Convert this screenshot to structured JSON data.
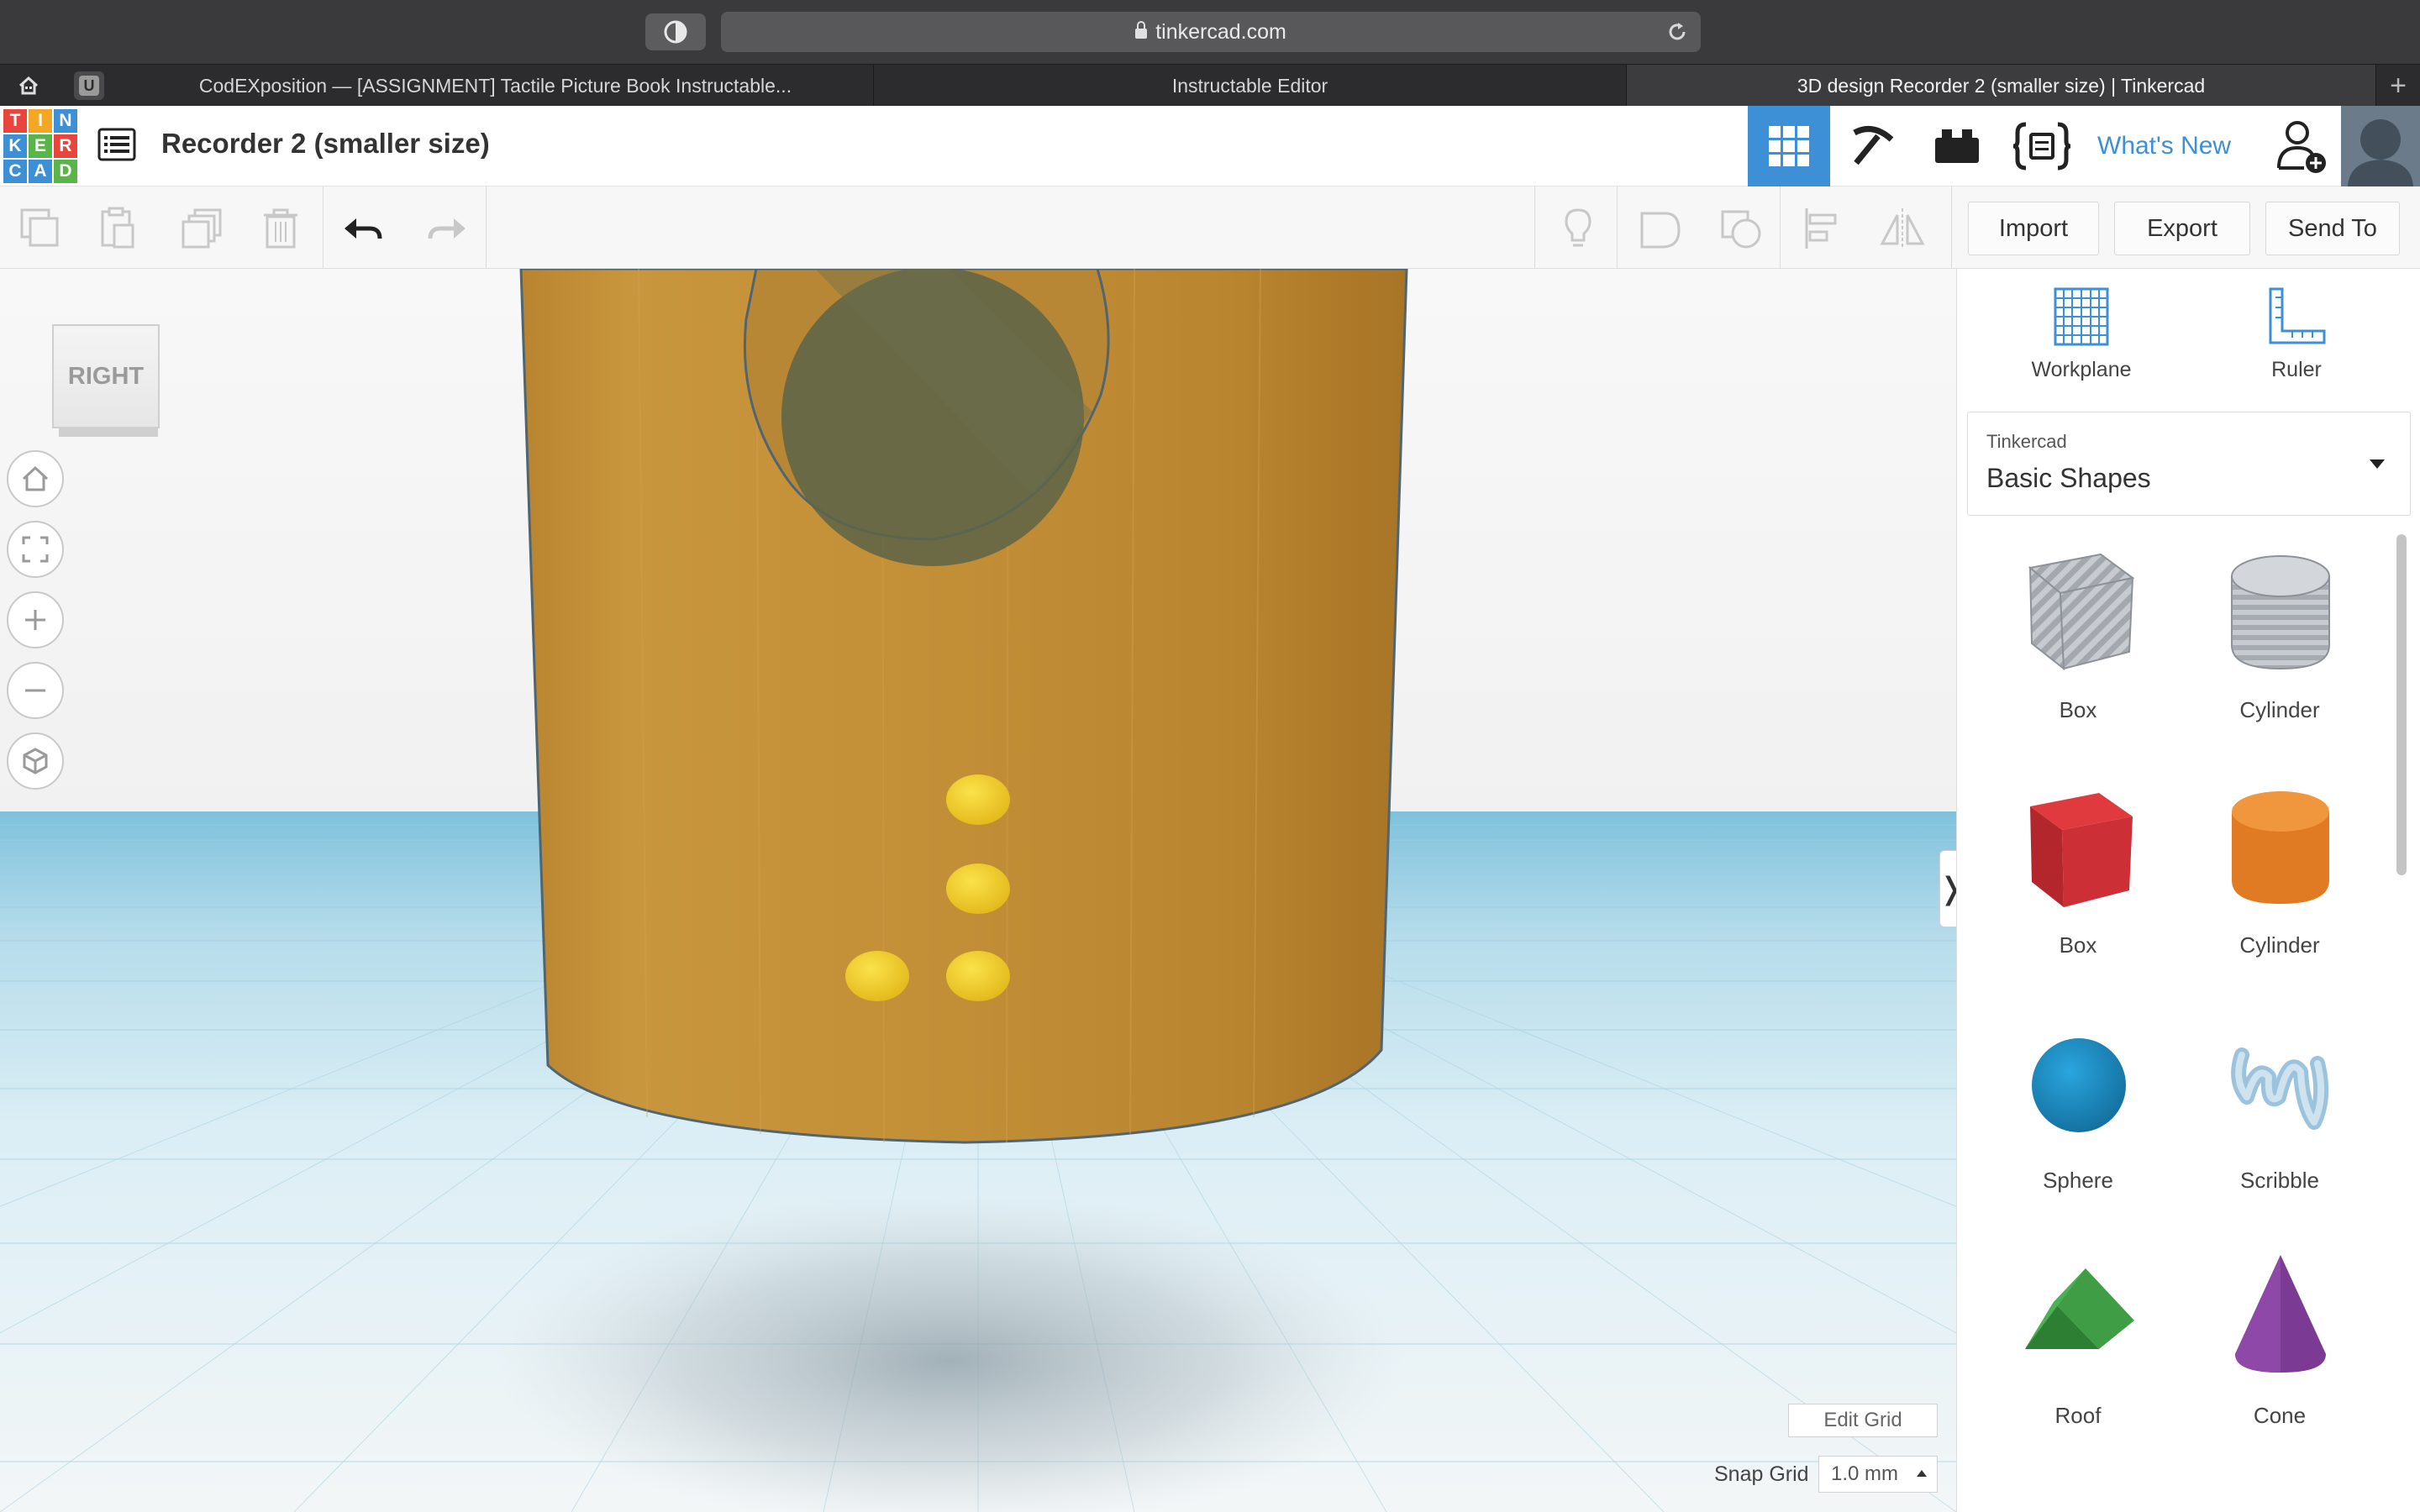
{
  "browser": {
    "url": "tinkercad.com",
    "tabs": [
      {
        "label": "CodEXposition — [ASSIGNMENT] Tactile Picture Book Instructable..."
      },
      {
        "label": "Instructable Editor"
      },
      {
        "label": "3D design Recorder 2 (smaller size) | Tinkercad"
      }
    ],
    "pinned_tab_letter": "U"
  },
  "header": {
    "logo_letters": [
      "T",
      "I",
      "N",
      "K",
      "E",
      "R",
      "C",
      "A",
      "D"
    ],
    "design_title": "Recorder 2 (smaller size)",
    "whats_new": "What's New"
  },
  "toolbar": {
    "import_label": "Import",
    "export_label": "Export",
    "send_to_label": "Send To"
  },
  "viewport": {
    "view_cube_label": "RIGHT",
    "edit_grid_label": "Edit Grid",
    "snap_grid_label": "Snap Grid",
    "snap_grid_value": "1.0 mm"
  },
  "panel": {
    "workplane_label": "Workplane",
    "ruler_label": "Ruler",
    "library_category": "Tinkercad",
    "library_value": "Basic Shapes",
    "shapes": [
      {
        "label": "Box"
      },
      {
        "label": "Cylinder"
      },
      {
        "label": "Box"
      },
      {
        "label": "Cylinder"
      },
      {
        "label": "Sphere"
      },
      {
        "label": "Scribble"
      },
      {
        "label": "Roof"
      },
      {
        "label": "Cone"
      }
    ]
  },
  "colors": {
    "accent": "#3d8fd6",
    "body_orange": "#c18f36",
    "braille_yellow": "#f3d02b",
    "workplane_blue": "#7fc2dc"
  }
}
